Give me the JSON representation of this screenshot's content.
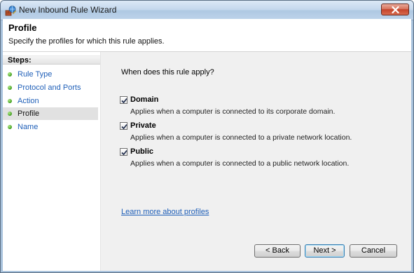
{
  "window": {
    "title": "New Inbound Rule Wizard",
    "icon": "firewall-wizard-icon"
  },
  "header": {
    "title": "Profile",
    "subtitle": "Specify the profiles for which this rule applies."
  },
  "steps": {
    "title": "Steps:",
    "items": [
      {
        "label": "Rule Type",
        "active": false
      },
      {
        "label": "Protocol and Ports",
        "active": false
      },
      {
        "label": "Action",
        "active": false
      },
      {
        "label": "Profile",
        "active": true
      },
      {
        "label": "Name",
        "active": false
      }
    ]
  },
  "main": {
    "question": "When does this rule apply?",
    "options": [
      {
        "label": "Domain",
        "description": "Applies when a computer is connected to its corporate domain.",
        "checked": true
      },
      {
        "label": "Private",
        "description": "Applies when a computer is connected to a private network location.",
        "checked": true
      },
      {
        "label": "Public",
        "description": "Applies when a computer is connected to a public network location.",
        "checked": true
      }
    ],
    "learn_more": "Learn more about profiles"
  },
  "buttons": {
    "back": "< Back",
    "next": "Next >",
    "cancel": "Cancel"
  }
}
